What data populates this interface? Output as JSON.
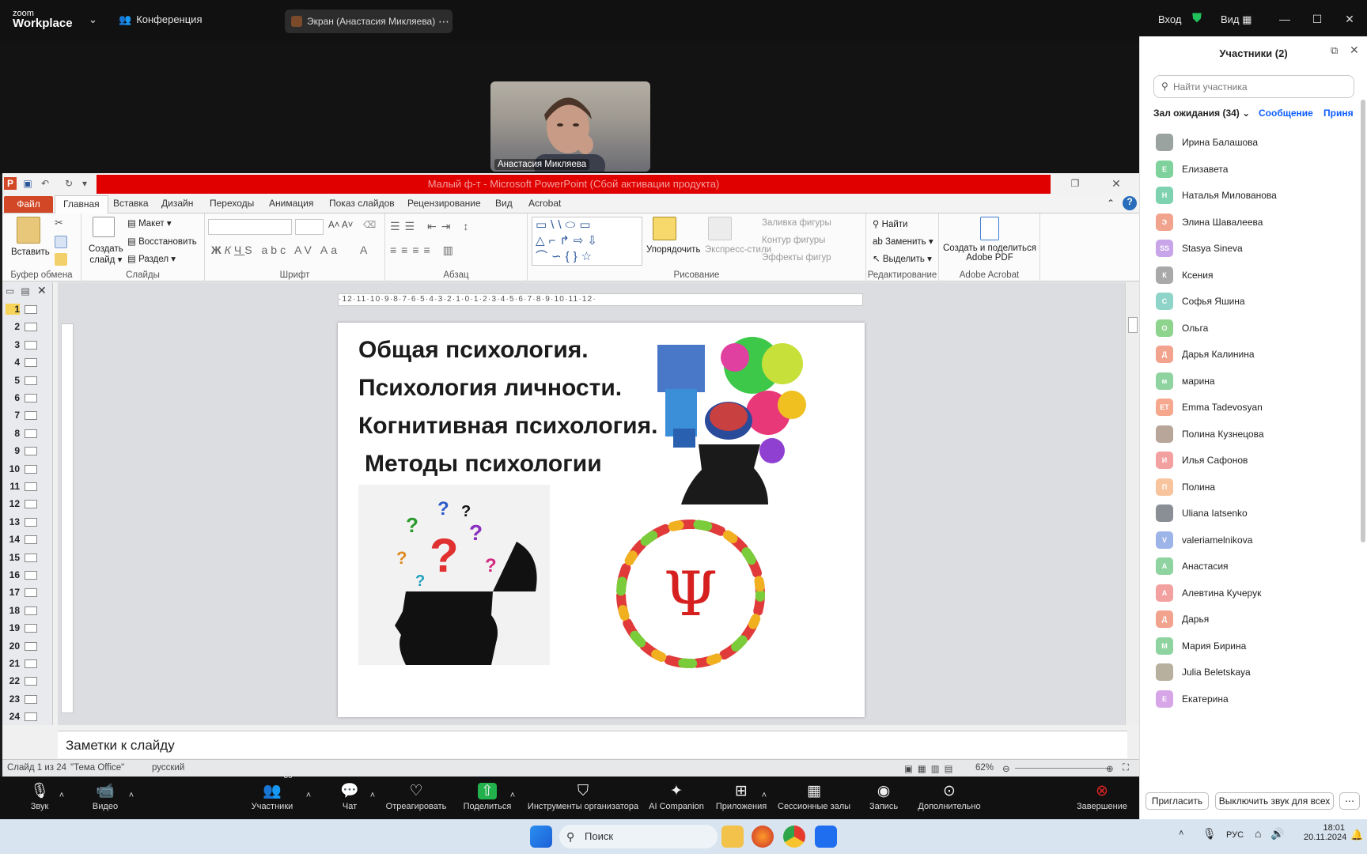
{
  "zoom": {
    "logo_top": "zoom",
    "logo_bottom": "Workplace",
    "meeting_title": "Конференция",
    "screen_share_label": "Экран (Анастасия Микляева)",
    "signin": "Вход",
    "view": "Вид",
    "video_name": "Анастасия Микляева"
  },
  "ppt": {
    "title": "Малый ф-т  -  Microsoft PowerPoint (Сбой активации продукта)",
    "tabs": [
      "Файл",
      "Главная",
      "Вставка",
      "Дизайн",
      "Переходы",
      "Анимация",
      "Показ слайдов",
      "Рецензирование",
      "Вид",
      "Acrobat"
    ],
    "ribbon": {
      "paste": "Вставить",
      "clipboard": "Буфер обмена",
      "new_slide_1": "Создать",
      "new_slide_2": "слайд",
      "layout": "Макет",
      "reset": "Восстановить",
      "section": "Раздел",
      "slides": "Слайды",
      "font": "Шрифт",
      "paragraph": "Абзац",
      "arrange": "Упорядочить",
      "quick_styles": "Экспресс-стили",
      "shape_fill": "Заливка фигуры",
      "shape_outline": "Контур фигуры",
      "shape_effects": "Эффекты фигур",
      "drawing": "Рисование",
      "find": "Найти",
      "replace": "Заменить",
      "select": "Выделить",
      "editing": "Редактирование",
      "create_share_1": "Создать и поделиться",
      "create_share_2": "Adobe PDF",
      "acrobat": "Adobe Acrobat"
    },
    "ruler": "·12·11·10·9·8·7·6·5·4·3·2·1·0·1·2·3·4·5·6·7·8·9·10·11·12·",
    "slide": {
      "line1": "Общая психология.",
      "line2": "Психология личности.",
      "line3": "Когнитивная психология.",
      "line4": "Методы психологии",
      "psi": "Ψ"
    },
    "thumb_numbers": [
      "1",
      "2",
      "3",
      "4",
      "5",
      "6",
      "7",
      "8",
      "9",
      "10",
      "11",
      "12",
      "13",
      "14",
      "15",
      "16",
      "17",
      "18",
      "19",
      "20",
      "21",
      "22",
      "23",
      "24"
    ],
    "notes": "Заметки к слайду",
    "status": {
      "slide": "Слайд 1 из 24",
      "theme": "\"Тема Office\"",
      "lang": "русский",
      "zoom": "62%"
    }
  },
  "panel": {
    "title": "Участники (2)",
    "search_placeholder": "Найти участника",
    "waiting": "Зал ожидания (34)",
    "message": "Сообщение",
    "admit": "Приня",
    "participants": [
      {
        "initial": "",
        "name": "Ирина Балашова",
        "color": "#9aa3a0"
      },
      {
        "initial": "Е",
        "name": "Елизавета",
        "color": "#7fd29b"
      },
      {
        "initial": "Н",
        "name": "Наталья Милованова",
        "color": "#7fd2b0"
      },
      {
        "initial": "Э",
        "name": "Элина Шавалеева",
        "color": "#f2a38e"
      },
      {
        "initial": "SS",
        "name": "Stasya Sineva",
        "color": "#c8a5e8"
      },
      {
        "initial": "К",
        "name": "Ксения",
        "color": "#a9a9a9"
      },
      {
        "initial": "С",
        "name": "Софья Яшина",
        "color": "#8fd4c8"
      },
      {
        "initial": "О",
        "name": "Ольга",
        "color": "#8ed38e"
      },
      {
        "initial": "Д",
        "name": "Дарья Калинина",
        "color": "#f2a38e"
      },
      {
        "initial": "м",
        "name": "марина",
        "color": "#8ed3a0"
      },
      {
        "initial": "ET",
        "name": "Emma Tadevosyan",
        "color": "#f5a88e"
      },
      {
        "initial": "",
        "name": "Полина Кузнецова",
        "color": "#b9a69a"
      },
      {
        "initial": "И",
        "name": "Илья Сафонов",
        "color": "#f2a0a0"
      },
      {
        "initial": "П",
        "name": "Полина",
        "color": "#f7c49e"
      },
      {
        "initial": "",
        "name": "Uliana Iatsenko",
        "color": "#8a8f96"
      },
      {
        "initial": "V",
        "name": "valeriamelnikova",
        "color": "#9db4e8"
      },
      {
        "initial": "А",
        "name": "Анастасия",
        "color": "#8ed3a0"
      },
      {
        "initial": "А",
        "name": "Алевтина Кучерук",
        "color": "#f2a0a0"
      },
      {
        "initial": "Д",
        "name": "Дарья",
        "color": "#f2a38e"
      },
      {
        "initial": "М",
        "name": "Мария Бирина",
        "color": "#8ed3a0"
      },
      {
        "initial": "",
        "name": "Julia Beletskaya",
        "color": "#b7b09e"
      },
      {
        "initial": "Е",
        "name": "Екатерина",
        "color": "#d6a6e8"
      }
    ],
    "invite": "Пригласить",
    "mute_all": "Выключить звук для всех"
  },
  "toolbar": {
    "audio": "Звук",
    "video": "Видео",
    "participants": "Участники",
    "participants_count": "36",
    "chat": "Чат",
    "react": "Отреагировать",
    "share": "Поделиться",
    "host_tools": "Инструменты организатора",
    "ai": "AI Companion",
    "apps": "Приложения",
    "breakout": "Сессионные залы",
    "record": "Запись",
    "more": "Дополнительно",
    "end": "Завершение"
  },
  "taskbar": {
    "search": "Поиск",
    "lang": "РУС",
    "time": "18:01",
    "date": "20.11.2024"
  }
}
